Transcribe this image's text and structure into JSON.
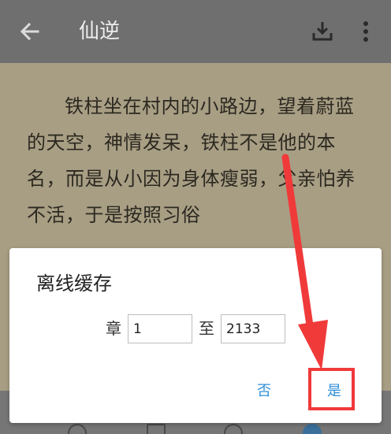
{
  "appbar": {
    "title": "仙逆",
    "back_icon": "arrow-left-icon",
    "download_icon": "download-icon",
    "more_icon": "more-vertical-icon"
  },
  "content": {
    "text": "铁柱坐在村内的小路边，望着蔚蓝的天空，神情发呆，铁柱不是他的本名，而是从小因为身体瘦弱，父亲怕养不活，于是按照习俗"
  },
  "dialog": {
    "title": "离线缓存",
    "chapter_label": "章",
    "to_label": "至",
    "start_value": "1",
    "end_value": "2133",
    "no_label": "否",
    "yes_label": "是"
  },
  "colors": {
    "accent": "#2f8fd8",
    "annotation": "#f03a3a"
  }
}
